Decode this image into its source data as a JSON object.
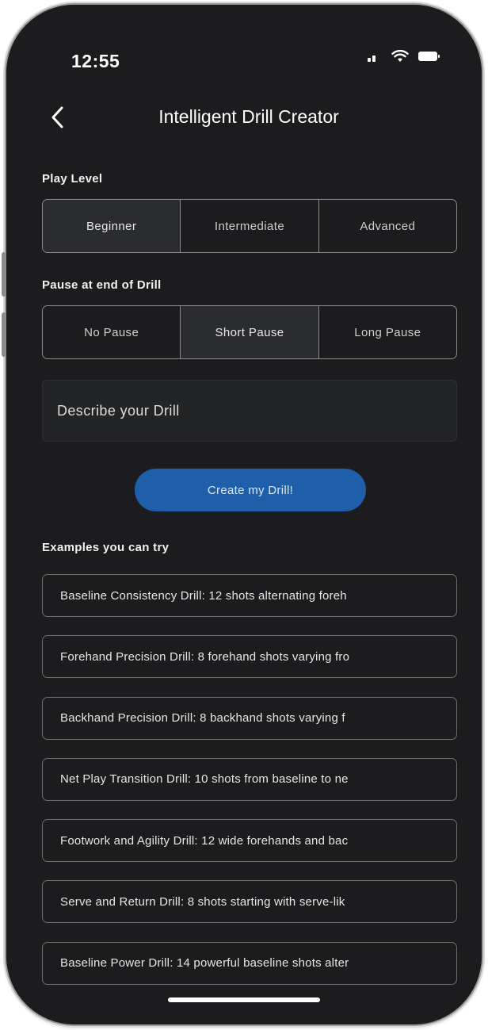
{
  "status_bar": {
    "time": "12:55"
  },
  "header": {
    "back_icon": "chevron-left-icon",
    "title": "Intelligent Drill Creator"
  },
  "play_level": {
    "label": "Play Level",
    "options": [
      "Beginner",
      "Intermediate",
      "Advanced"
    ],
    "selected": "Beginner"
  },
  "pause": {
    "label": "Pause at end of Drill",
    "options": [
      "No Pause",
      "Short Pause",
      "Long Pause"
    ],
    "selected": "Short Pause"
  },
  "describe": {
    "placeholder": "Describe your Drill",
    "value": ""
  },
  "create_button": {
    "label": "Create my Drill!",
    "color": "#1f5ea8"
  },
  "examples": {
    "label": "Examples you can try",
    "items": [
      "Baseline Consistency Drill: 12 shots alternating foreh",
      "Forehand Precision Drill: 8 forehand shots varying fro",
      "Backhand Precision Drill: 8 backhand shots varying f",
      "Net Play Transition Drill: 10 shots from baseline to ne",
      "Footwork and Agility Drill: 12 wide forehands and bac",
      "Serve and Return Drill: 8 shots starting with serve-lik",
      "Baseline Power Drill: 14 powerful baseline shots alter"
    ]
  }
}
